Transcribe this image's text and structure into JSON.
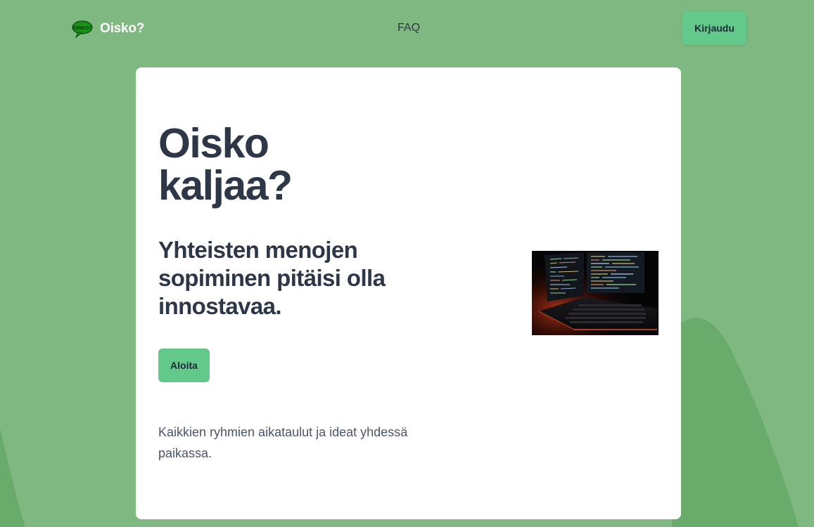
{
  "header": {
    "brand_name": "Oisko?",
    "logo_text": "OISKO?",
    "nav_faq": "FAQ",
    "login_label": "Kirjaudu"
  },
  "hero": {
    "title_line1": "Oisko",
    "title_line2": "kaljaa?",
    "subtitle_line1": "Yhteisten menojen",
    "subtitle_line2": "sopiminen pitäisi olla",
    "subtitle_line3": "innostavaa.",
    "start_label": "Aloita",
    "desc_line1": "Kaikkien ryhmien aikataulut ja ideat yhdessä",
    "desc_line2": "paikassa.",
    "image_icon": "laptop-code-photo"
  },
  "colors": {
    "background": "#80b882",
    "background_shape": "#69ab6b",
    "accent_button": "#63c98a",
    "heading_text": "#2d3748",
    "body_text": "#4a5568",
    "card": "#ffffff"
  }
}
